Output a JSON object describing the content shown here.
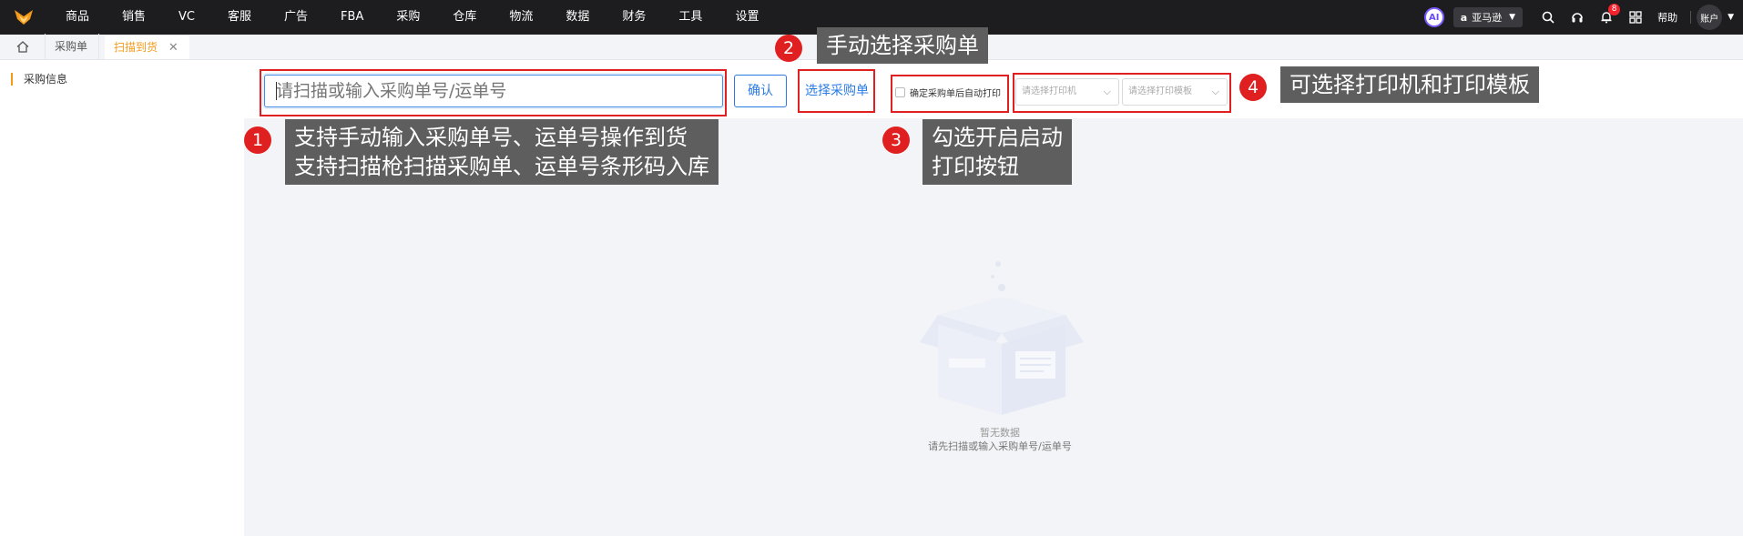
{
  "topnav": {
    "items": [
      "商品",
      "销售",
      "VC",
      "客服",
      "广告",
      "FBA",
      "采购",
      "仓库",
      "物流",
      "数据",
      "财务",
      "工具",
      "设置"
    ]
  },
  "topright": {
    "ai_label": "AI",
    "store_label": "亚马逊",
    "notification_count": "8",
    "help_label": "帮助",
    "account_label": "账户"
  },
  "tabs": {
    "items": [
      {
        "label": "采购单",
        "active": false
      },
      {
        "label": "扫描到货",
        "active": true
      }
    ]
  },
  "sidebar": {
    "item_label": "采购信息"
  },
  "toolbar": {
    "scan_placeholder": "请扫描或输入采购单号/运单号",
    "confirm_label": "确认",
    "select_order_label": "选择采购单",
    "auto_print_label": "确定采购单后自动打印",
    "printer_placeholder": "请选择打印机",
    "template_placeholder": "请选择打印模板"
  },
  "empty": {
    "title": "暂无数据",
    "desc": "请先扫描或输入采购单号/运单号"
  },
  "annotations": [
    {
      "num": "1",
      "lines": [
        "支持手动输入采购单号、运单号操作到货",
        "支持扫描枪扫描采购单、运单号条形码入库"
      ]
    },
    {
      "num": "2",
      "lines": [
        "手动选择采购单"
      ]
    },
    {
      "num": "3",
      "lines": [
        "勾选开启启动",
        "打印按钮"
      ]
    },
    {
      "num": "4",
      "lines": [
        "可选择打印机和打印模板"
      ]
    }
  ],
  "colors": {
    "topbar": "#1d1d1f",
    "accent_orange": "#f39a1a",
    "link_blue": "#2a7be4",
    "annotation_red": "#e02020",
    "callout_gray": "#5e5e5e"
  }
}
